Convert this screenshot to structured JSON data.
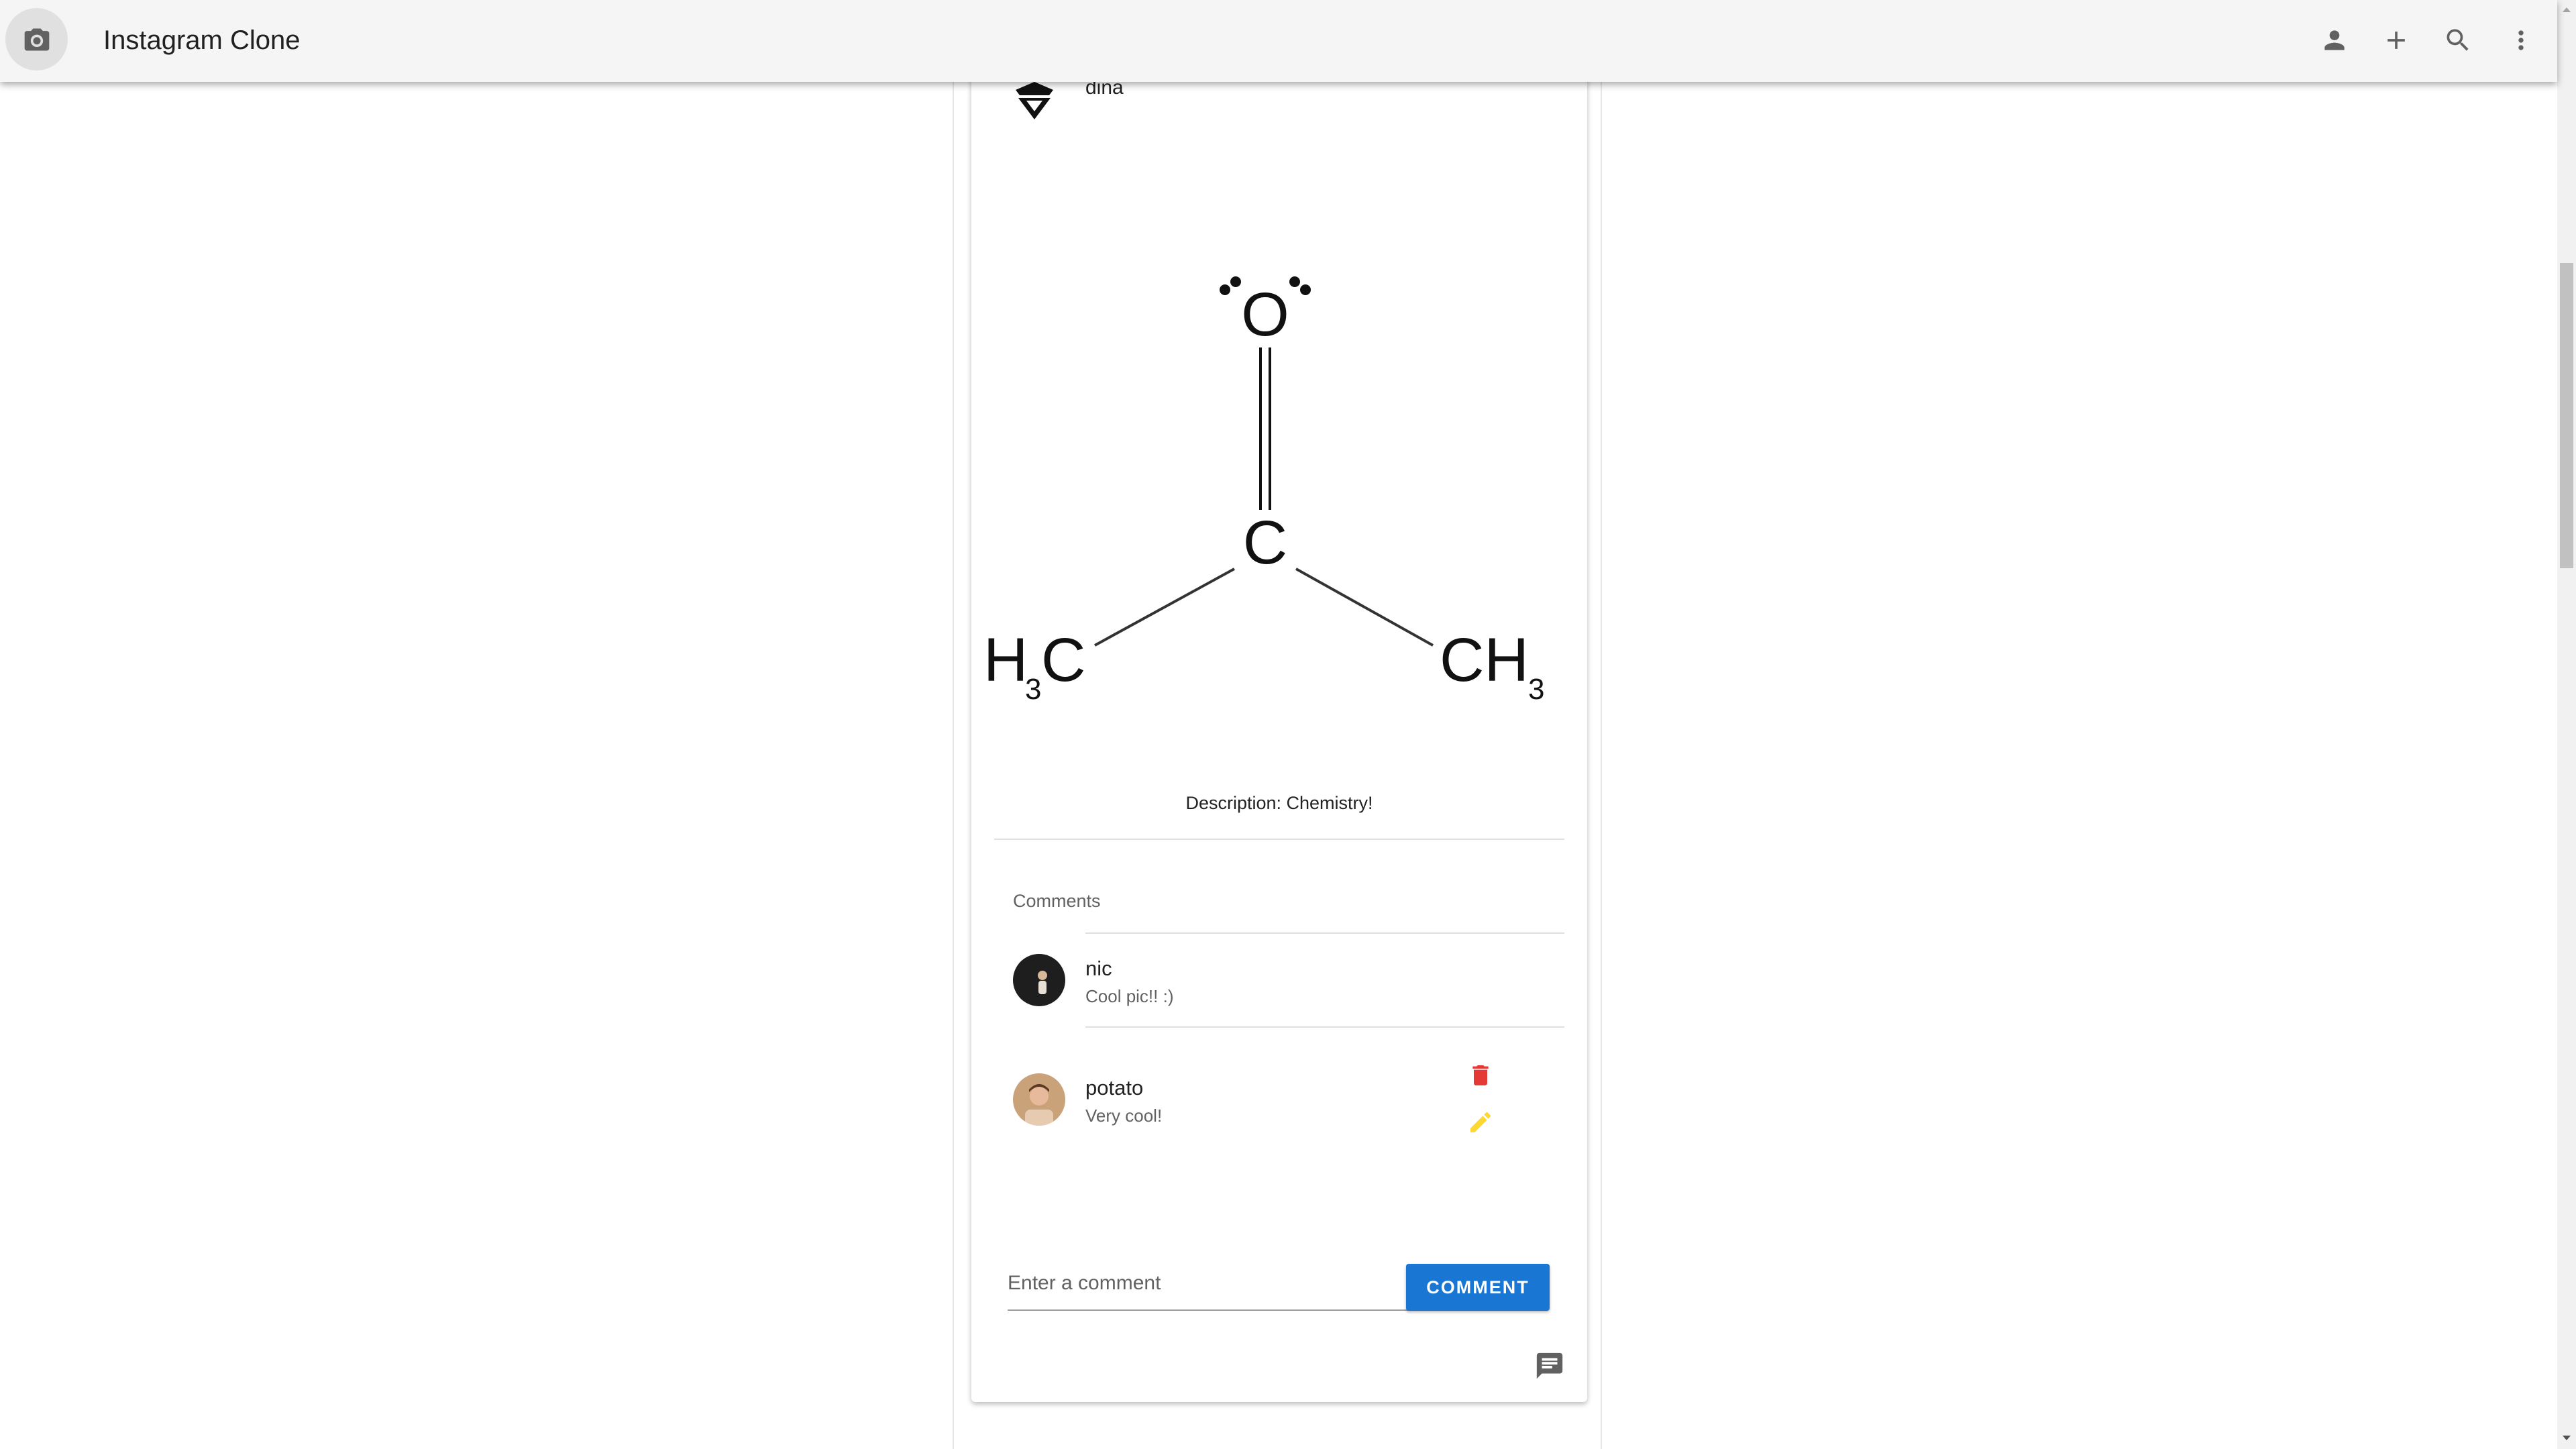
{
  "header": {
    "title": "Instagram Clone",
    "icons": [
      "camera-icon",
      "person-icon",
      "add-icon",
      "search-icon",
      "more-vert-icon"
    ]
  },
  "post": {
    "username": "dina",
    "description": "Description: Chemistry!",
    "image": {
      "labels": {
        "oxygen": "O",
        "carbon": "C",
        "left_group": "H",
        "left_group_c": "C",
        "right_group": "CH",
        "subscript": "3"
      }
    }
  },
  "comments": {
    "header": "Comments",
    "items": [
      {
        "user": "nic",
        "text": "Cool pic!! :)"
      },
      {
        "user": "potato",
        "text": "Very cool!"
      }
    ]
  },
  "comment_form": {
    "placeholder": "Enter a comment",
    "button_label": "COMMENT"
  },
  "colors": {
    "app_bar": "#f5f5f5",
    "primary_button": "#1976d2",
    "delete_icon": "#e53935",
    "edit_icon": "#fdd835"
  }
}
